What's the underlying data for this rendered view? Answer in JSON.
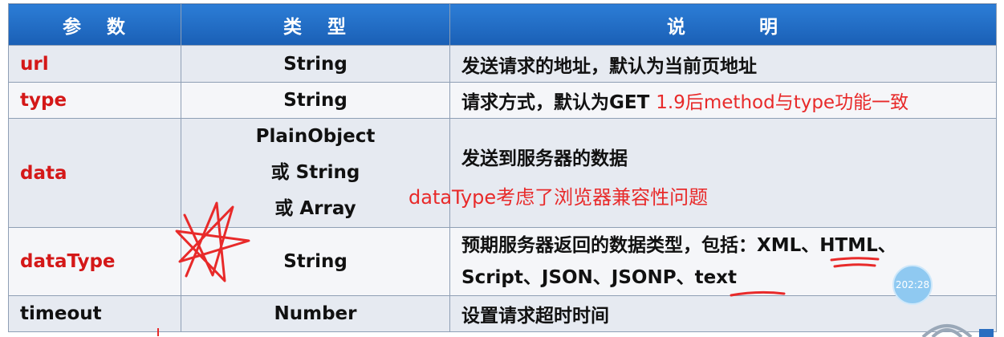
{
  "header": {
    "param": [
      "参",
      "数"
    ],
    "type": [
      "类",
      "型"
    ],
    "desc": [
      "说",
      "明"
    ]
  },
  "rows": [
    {
      "param": "url",
      "type": "String",
      "desc": "发送请求的地址，默认为当前页地址"
    },
    {
      "param": "type",
      "type": "String",
      "desc": "请求方式，默认为GET",
      "annotation": "1.9后method与type功能一致"
    },
    {
      "param": "data",
      "type_lines": [
        "PlainObject",
        "或 String",
        "或 Array"
      ],
      "desc": "发送到服务器的数据",
      "annotation": "dataType考虑了浏览器兼容性问题"
    },
    {
      "param": "dataType",
      "type": "String",
      "desc_lines": [
        "预期服务器返回的数据类型，包括：XML、HTML、",
        "Script、JSON、JSONP、text"
      ]
    },
    {
      "param": "timeout",
      "type": "Number",
      "desc": "设置请求超时时间"
    }
  ],
  "overlay": {
    "timer_label": "202:28",
    "ink_color": "#e82a2a",
    "header_color": "#1f6bc4",
    "param_color": "#d41818"
  }
}
